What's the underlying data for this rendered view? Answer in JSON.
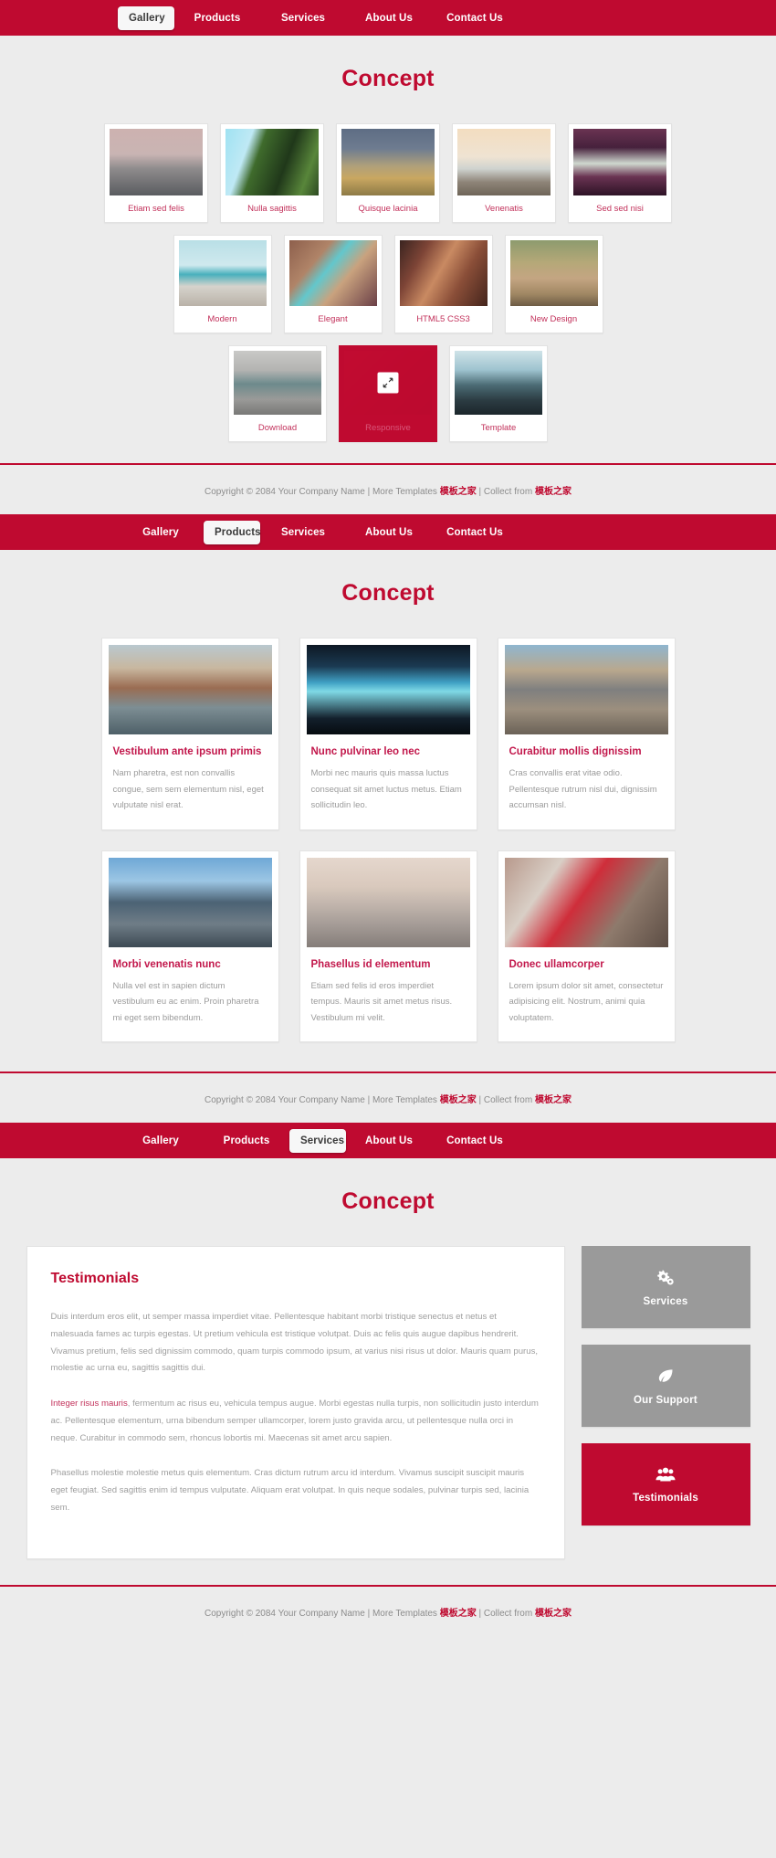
{
  "brand_color": "#bf0a30",
  "accent_text_color": "#c2305a",
  "nav": {
    "items": [
      "Gallery",
      "Products",
      "Services",
      "About Us",
      "Contact Us"
    ],
    "active_section_1": "Gallery",
    "active_section_2": "Products",
    "active_section_3": "Services"
  },
  "sections": {
    "gallery": {
      "title": "Concept",
      "row1": [
        {
          "caption": "Etiam sed felis",
          "image": "seascape-photo",
          "img_class": "im-sea"
        },
        {
          "caption": "Nulla sagittis",
          "image": "green-cliff-road-photo",
          "img_class": "im-road"
        },
        {
          "caption": "Quisque lacinia",
          "image": "wheat-field-clouds-photo",
          "img_class": "im-field"
        },
        {
          "caption": "Venenatis",
          "image": "rocks-pole-sea-photo",
          "img_class": "im-pole"
        },
        {
          "caption": "Sed sed nisi",
          "image": "canal-buildings-photo",
          "img_class": "im-canal"
        }
      ],
      "row2": [
        {
          "caption": "Modern",
          "image": "pelican-pier-photo",
          "img_class": "im-pelican"
        },
        {
          "caption": "Elegant",
          "image": "coffee-cup-pastry-photo",
          "img_class": "im-coffee"
        },
        {
          "caption": "HTML5 CSS3",
          "image": "brick-fire-escape-photo",
          "img_class": "im-brick"
        },
        {
          "caption": "New Design",
          "image": "dirt-road-animal-photo",
          "img_class": "im-dirt"
        }
      ],
      "row3": [
        {
          "caption": "Download",
          "image": "vintage-van-traffic-photo",
          "img_class": "im-van",
          "hovered": false
        },
        {
          "caption": "Responsive",
          "image": "responsive-devices-photo",
          "img_class": "im-resp",
          "hovered": true
        },
        {
          "caption": "Template",
          "image": "rocky-coast-waves-photo",
          "img_class": "im-coast",
          "hovered": false
        }
      ],
      "hover_icon": "expand-arrows-icon"
    },
    "products": {
      "title": "Concept",
      "cards": [
        {
          "heading": "Vestibulum ante ipsum primis",
          "body": "Nam pharetra, est non convallis congue, sem sem elementum nisl, eget vulputate nisl erat.",
          "image": "venice-canal-boats-photo",
          "img_class": "im-venice"
        },
        {
          "heading": "Nunc pulvinar leo nec",
          "body": "Morbi nec mauris quis massa luctus consequat sit amet luctus metus. Etiam sollicitudin leo.",
          "image": "concert-stage-lights-photo",
          "img_class": "im-concert"
        },
        {
          "heading": "Curabitur mollis dignissim",
          "body": "Cras convallis erat vitae odio. Pellentesque rutrum nisl dui, dignissim accumsan nisl.",
          "image": "railway-tracks-photo",
          "img_class": "im-rail"
        },
        {
          "heading": "Morbi venenatis nunc",
          "body": "Nulla vel est in sapien dictum vestibulum eu ac enim. Proin pharetra mi eget sem bibendum.",
          "image": "city-skyline-photo",
          "img_class": "im-city"
        },
        {
          "heading": "Phasellus id elementum",
          "body": "Etiam sed felis id eros imperdiet tempus. Mauris sit amet metus risus. Vestibulum mi velit.",
          "image": "foggy-beach-photo",
          "img_class": "im-beach"
        },
        {
          "heading": "Donec ullamcorper",
          "body": "Lorem ipsum dolor sit amet, consectetur adipisicing elit. Nostrum, animi quia voluptatem.",
          "image": "red-tricycle-wall-photo",
          "img_class": "im-trike"
        }
      ]
    },
    "testimonials": {
      "title": "Concept",
      "panel_heading": "Testimonials",
      "paragraph_1": "Duis interdum eros elit, ut semper massa imperdiet vitae. Pellentesque habitant morbi tristique senectus et netus et malesuada fames ac turpis egestas. Ut pretium vehicula est tristique volutpat. Duis ac felis quis augue dapibus hendrerit. Vivamus pretium, felis sed dignissim commodo, quam turpis commodo ipsum, at varius nisi risus ut dolor. Mauris quam purus, molestie ac urna eu, sagittis sagittis dui.",
      "paragraph_2_highlight": "Integer risus mauris",
      "paragraph_2": ", fermentum ac risus eu, vehicula tempus augue. Morbi egestas nulla turpis, non sollicitudin justo interdum ac. Pellentesque elementum, urna bibendum semper ullamcorper, lorem justo gravida arcu, ut pellentesque nulla orci in neque. Curabitur in commodo sem, rhoncus lobortis mi. Maecenas sit amet arcu sapien.",
      "paragraph_3": "Phasellus molestie molestie metus quis elementum. Cras dictum rutrum arcu id interdum. Vivamus suscipit suscipit mauris eget feugiat. Sed sagittis enim id tempus vulputate. Aliquam erat volutpat. In quis neque sodales, pulvinar turpis sed, lacinia sem.",
      "widgets": [
        {
          "label": "Services",
          "icon": "gears-icon",
          "active": false
        },
        {
          "label": "Our Support",
          "icon": "leaf-icon",
          "active": false
        },
        {
          "label": "Testimonials",
          "icon": "users-group-icon",
          "active": true
        }
      ]
    }
  },
  "footer": {
    "copyright": "Copyright © 2084 Your Company Name | More Templates ",
    "link_1": "模板之家",
    "middle": " | Collect from ",
    "link_2": "模板之家"
  }
}
